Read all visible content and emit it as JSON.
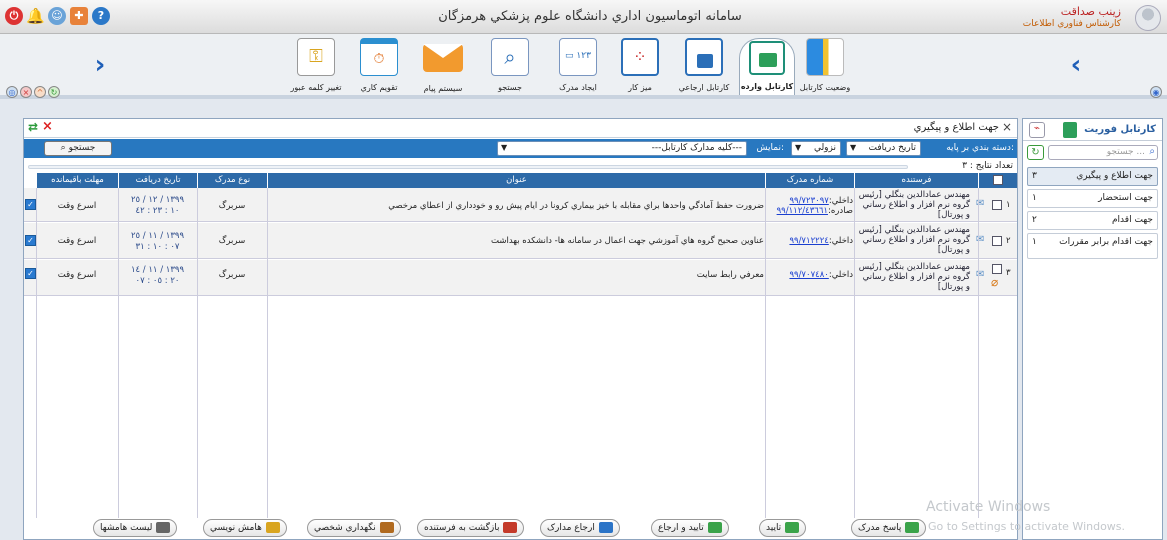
{
  "app": {
    "title": "سامانه اتوماسيون اداري دانشگاه علوم پزشکي هرمزگان"
  },
  "user": {
    "name": "زينب صداقت",
    "role": "کارشناس فناوري اطلاعات"
  },
  "toolbar": {
    "items": [
      {
        "label": "وضعيت کارتابل",
        "icon": "cartable-status-icon"
      },
      {
        "label": "کارتابل وارده",
        "icon": "inbox-cartable-icon",
        "active": true
      },
      {
        "label": "کارتابل ارجاعي",
        "icon": "referral-cartable-icon"
      },
      {
        "label": "ميز کار",
        "icon": "desk-icon"
      },
      {
        "label": "ايجاد مدرک",
        "icon": "create-document-icon"
      },
      {
        "label": "جستجو",
        "icon": "search-icon"
      },
      {
        "label": "سيستم پيام",
        "icon": "message-icon"
      },
      {
        "label": "تقويم کاري",
        "icon": "calendar-icon"
      },
      {
        "label": "تغيير کلمه عبور",
        "icon": "password-icon"
      }
    ]
  },
  "panel": {
    "title": "جهت اطلاع و پيگيري",
    "filter": {
      "group_label": "دسته بندي بر پايه:",
      "group_value": "تاريخ دريافت",
      "order_value": "نزولي",
      "show_label": "نمايش:",
      "show_value": "---کليه مدارک کارتابل---",
      "search_button": "جستجو"
    },
    "results_label": "تعداد نتايج : ٣",
    "columns": [
      "فرستنده",
      "شماره مدرک",
      "عنوان",
      "نوع مدرک",
      "تاريخ دريافت",
      "مهلت باقيمانده"
    ],
    "rows": [
      {
        "num": "١",
        "sender": "مهندس عمادالدين بنگلي [رئيس گروه نرم افزار و اطلاع رساني و پورتال]",
        "doc_prefix1": "داخلي:",
        "doc_no1": "٩٩/٧٢٣٠٩٧",
        "doc_prefix2": "صادره:",
        "doc_no2": "٩٩/١١٢/٤٣٦٦١",
        "subject": "ضرورت حفظ آمادگي واحدها براي مقابله با خيز بيماري کرونا در ايام پيش رو و خودداري از اعطاي مرخصي",
        "type": "سربرگ",
        "date": "١٣٩٩ / ١٢ / ٢٥",
        "time": "١٠ : ٢٣ : ٤٢",
        "deadline": "اسرع وقت"
      },
      {
        "num": "٢",
        "sender": "مهندس عمادالدين بنگلي [رئيس گروه نرم افزار و اطلاع رساني و پورتال]",
        "doc_prefix1": "داخلي:",
        "doc_no1": "٩٩/٧١٢٢٢٤",
        "subject": "عناوين صحيح گروه هاي آموزشي جهت اعمال در سامانه ها- دانشكده بهداشت",
        "type": "سربرگ",
        "date": "١٣٩٩ / ١١ / ٢٥",
        "time": "٠٧ : ١٠ : ٣١",
        "deadline": "اسرع وقت"
      },
      {
        "num": "٣",
        "sender": "مهندس عمادالدين بنگلي [رئيس گروه نرم افزار و اطلاع رساني و پورتال]",
        "doc_prefix1": "داخلي:",
        "doc_no1": "٩٩/٧٠٧٤٨٠",
        "subject": "معرفي رابط سايت",
        "type": "سربرگ",
        "date": "١٣٩٩ / ١١ / ١٤",
        "time": "٢٠ : ٠٥ : ٠٧",
        "deadline": "اسرع وقت"
      }
    ]
  },
  "actions": [
    {
      "label": "پاسخ مدرک",
      "icon": "reply-icon",
      "color": "#3aa34a"
    },
    {
      "label": "تاييد",
      "icon": "approve-icon",
      "color": "#3aa34a"
    },
    {
      "label": "تاييد و ارجاع",
      "icon": "approve-refer-icon",
      "color": "#3aa34a"
    },
    {
      "label": "ارجاع مدارک",
      "icon": "refer-icon",
      "color": "#2b74c7"
    },
    {
      "label": "بازگشت به فرستنده",
      "icon": "return-icon",
      "color": "#c43a2a"
    },
    {
      "label": "نگهداري شخصي",
      "icon": "keep-icon",
      "color": "#b06a20"
    },
    {
      "label": "هامش نويسي",
      "icon": "note-icon",
      "color": "#d9a520"
    },
    {
      "label": "ليست هامشها",
      "icon": "notes-list-icon",
      "color": "#666"
    }
  ],
  "sidebar": {
    "title": "کارتابل فوريت",
    "search_placeholder": "جستجو ...",
    "items": [
      {
        "label": "جهت اطلاع و پيگيري",
        "count": "٣"
      },
      {
        "label": "جهت استحضار",
        "count": "١"
      },
      {
        "label": "جهت اقدام",
        "count": "٢"
      },
      {
        "label": "جهت اقدام برابر مقررات",
        "count": "١"
      }
    ]
  },
  "watermark": {
    "line1": "Activate Windows",
    "line2": "Go to Settings to activate Windows."
  }
}
